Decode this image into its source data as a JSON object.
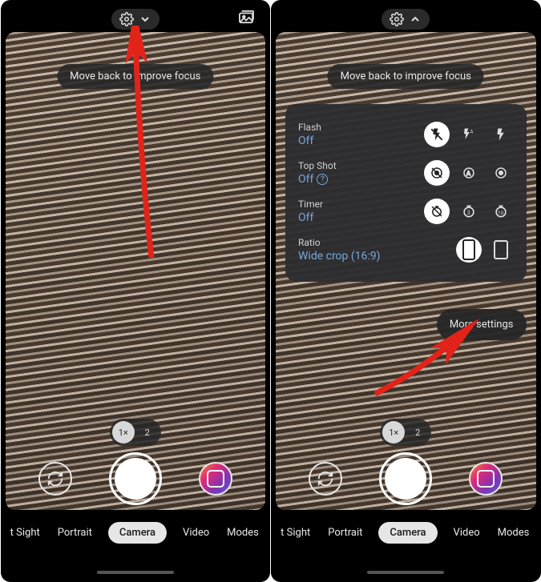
{
  "left": {
    "toast": "Move back to improve focus",
    "zoom": {
      "options": [
        "1×",
        "2"
      ],
      "selected_index": 0
    },
    "modes": [
      "t Sight",
      "Portrait",
      "Camera",
      "Video",
      "Modes"
    ],
    "selected_mode_index": 2,
    "chevron_direction": "down"
  },
  "right": {
    "toast": "Move back to improve focus",
    "zoom": {
      "options": [
        "1×",
        "2"
      ],
      "selected_index": 0
    },
    "modes": [
      "t Sight",
      "Portrait",
      "Camera",
      "Video",
      "Modes"
    ],
    "selected_mode_index": 2,
    "chevron_direction": "up",
    "settings": {
      "flash": {
        "label": "Flash",
        "value": "Off",
        "toggles": [
          "flash-off-icon",
          "flash-auto-icon",
          "flash-on-icon"
        ],
        "selected_index": 0
      },
      "top_shot": {
        "label": "Top Shot",
        "value": "Off",
        "has_info": true,
        "toggles": [
          "topshot-off-icon",
          "topshot-auto-icon",
          "topshot-on-icon"
        ],
        "selected_index": 0
      },
      "timer": {
        "label": "Timer",
        "value": "Off",
        "toggles": [
          "timer-off-icon",
          "timer-3s-icon",
          "timer-10s-icon"
        ],
        "selected_index": 0
      },
      "ratio": {
        "label": "Ratio",
        "value": "Wide crop (16:9)",
        "toggles": [
          "ratio-16-9-icon",
          "ratio-4-3-icon"
        ],
        "selected_index": 0
      }
    },
    "more_settings_label": "More settings"
  }
}
